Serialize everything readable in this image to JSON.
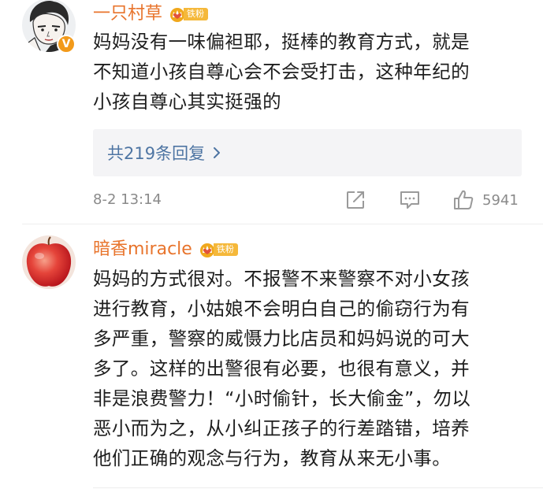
{
  "comments": [
    {
      "username": "一只村草",
      "fan_badge": "铁粉",
      "verified_mark": "V",
      "avatar": "cartoon-boy-avatar",
      "lines": [
        "妈妈没有一味偏袒耶，挺棒的教育方式，就是",
        "不知道小孩自尊心会不会受打击，这种年纪的",
        "小孩自尊心其实挺强的"
      ],
      "reply_label": "共219条回复",
      "timestamp": "8-2 13:14",
      "like_count": "5941"
    },
    {
      "username": "暗香miracle",
      "fan_badge": "铁粉",
      "avatar": "red-apple-avatar",
      "lines": [
        "妈妈的方式很对。不报警不来警察不对小女孩",
        "进行教育，小姑娘不会明白自己的偷窃行为有",
        "多严重，警察的威慑力比店员和妈妈说的可大",
        "多了。这样的出警很有必要，也很有意义，并",
        "非是浪费警力！“小时偷针，长大偷金”，勿以",
        "恶小而为之，从小纠正孩子的行差踏错，培养",
        "他们正确的观念与行为，教育从来无小事。"
      ]
    }
  ],
  "colors": {
    "username": "#e8742c",
    "reply_link": "#4e75a3",
    "meta_gray": "#8a8a8a",
    "fan_badge": "#f5b83a",
    "verified": "#f29a1a"
  }
}
